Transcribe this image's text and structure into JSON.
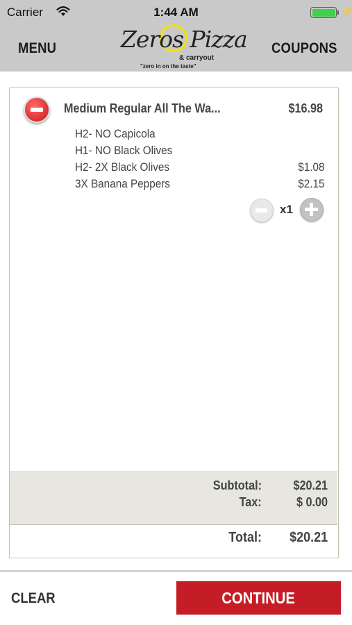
{
  "status_bar": {
    "carrier": "Carrier",
    "time": "1:44 AM",
    "bolt": "⚡"
  },
  "nav": {
    "menu_label": "MENU",
    "coupons_label": "COUPONS",
    "logo": {
      "script": "Zeros Pizza",
      "sub": "& carryout",
      "tagline": "\"zero in on the taste\""
    }
  },
  "order": {
    "item": {
      "name": "Medium Regular  All The Wa...",
      "price": "$16.98",
      "modifiers": [
        {
          "label": "H2- NO Capicola",
          "price": ""
        },
        {
          "label": "H1- NO Black Olives",
          "price": ""
        },
        {
          "label": "H2- 2X Black Olives",
          "price": "$1.08"
        },
        {
          "label": "3X Banana Peppers",
          "price": "$2.15"
        }
      ],
      "quantity_label": "x1"
    },
    "summary": {
      "subtotal_label": "Subtotal:",
      "subtotal_value": "$20.21",
      "tax_label": "Tax:",
      "tax_value": "$ 0.00",
      "total_label": "Total:",
      "total_value": "$20.21"
    }
  },
  "footer": {
    "clear_label": "CLEAR",
    "continue_label": "CONTINUE"
  },
  "colors": {
    "header_bg": "#c9c9c9",
    "continue_bg": "#c51d25",
    "battery": "#3fd14d",
    "summary_bg": "#e7e6df"
  },
  "icons": [
    "wifi-icon",
    "battery-icon",
    "charging-bolt-icon",
    "remove-item-icon",
    "decrease-quantity-icon",
    "increase-quantity-icon"
  ]
}
